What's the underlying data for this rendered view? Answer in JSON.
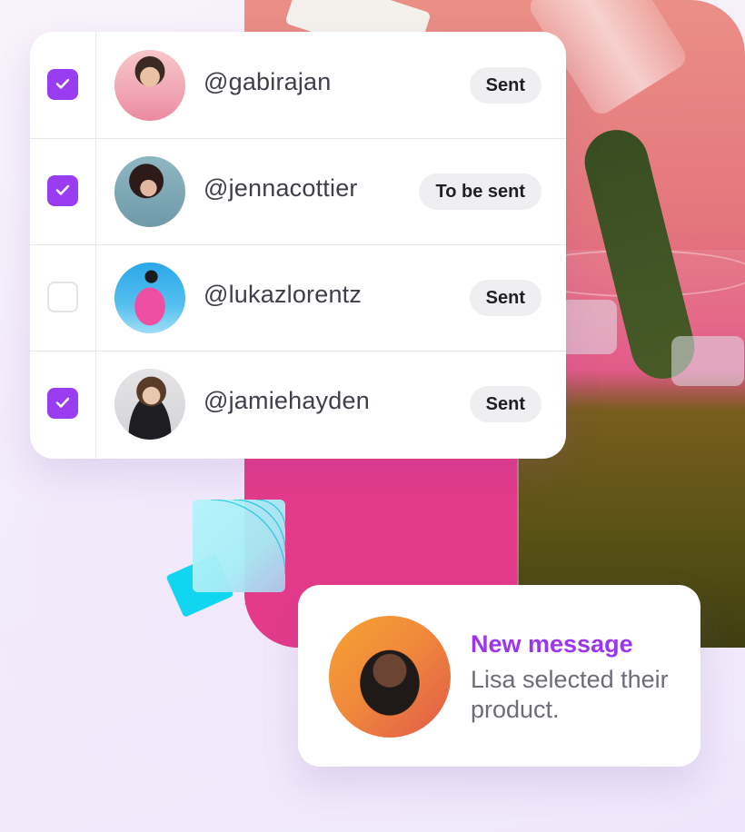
{
  "list": {
    "rows": [
      {
        "handle": "@gabirajan",
        "status": "Sent",
        "checked": true
      },
      {
        "handle": "@jennacottier",
        "status": "To be sent",
        "checked": true
      },
      {
        "handle": "@lukazlorentz",
        "status": "Sent",
        "checked": false
      },
      {
        "handle": "@jamiehayden",
        "status": "Sent",
        "checked": true
      }
    ]
  },
  "notification": {
    "title": "New message",
    "body": "Lisa selected their product."
  },
  "colors": {
    "accent": "#9a3cf0",
    "notification_title": "#9b35ef",
    "pill_bg": "#efeff1",
    "photo_pink": "#e23d86",
    "tile_cyan": "#12d6ef"
  }
}
